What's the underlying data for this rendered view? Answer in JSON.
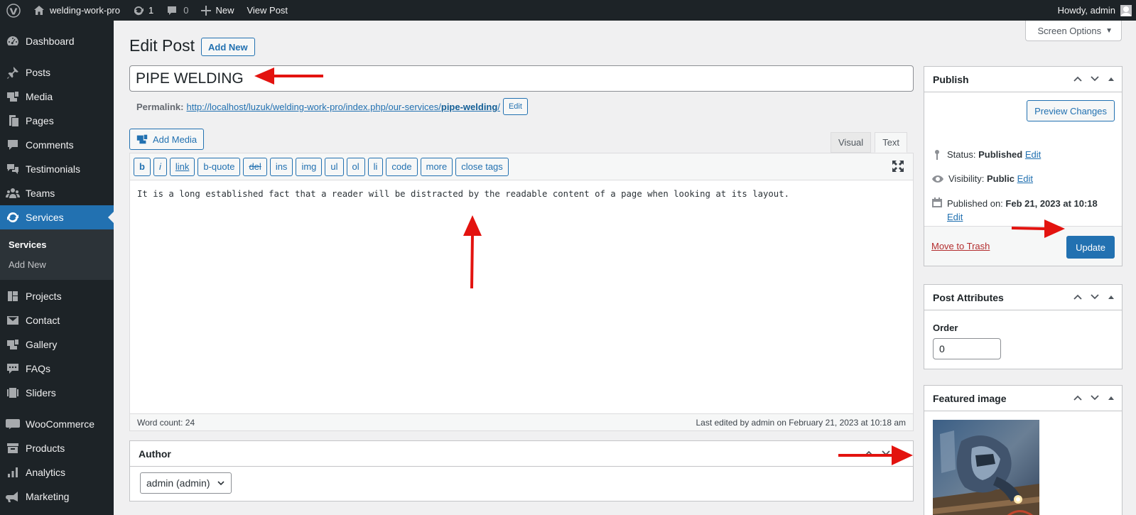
{
  "adminbar": {
    "site_name": "welding-work-pro",
    "updates_count": "1",
    "comments_count": "0",
    "new_label": "New",
    "view_post_label": "View Post",
    "howdy_label": "Howdy, admin"
  },
  "sidebar": {
    "items": [
      {
        "label": "Dashboard",
        "icon": "dashboard-icon"
      },
      {
        "label": "Posts",
        "icon": "pin-icon"
      },
      {
        "label": "Media",
        "icon": "media-icon"
      },
      {
        "label": "Pages",
        "icon": "pages-icon"
      },
      {
        "label": "Comments",
        "icon": "comment-icon"
      },
      {
        "label": "Testimonials",
        "icon": "testimonial-icon"
      },
      {
        "label": "Teams",
        "icon": "groups-icon"
      },
      {
        "label": "Services",
        "icon": "update-icon"
      },
      {
        "label": "Projects",
        "icon": "portfolio-icon"
      },
      {
        "label": "Contact",
        "icon": "email-icon"
      },
      {
        "label": "Gallery",
        "icon": "gallery-icon"
      },
      {
        "label": "FAQs",
        "icon": "faq-icon"
      },
      {
        "label": "Sliders",
        "icon": "slides-icon"
      },
      {
        "label": "WooCommerce",
        "icon": "woo-icon"
      },
      {
        "label": "Products",
        "icon": "archive-icon"
      },
      {
        "label": "Analytics",
        "icon": "chart-icon"
      },
      {
        "label": "Marketing",
        "icon": "megaphone-icon"
      }
    ],
    "submenu": [
      "Services",
      "Add New"
    ]
  },
  "header": {
    "screen_options": "Screen Options",
    "title": "Edit Post",
    "add_new": "Add New"
  },
  "post": {
    "title": "PIPE WELDING",
    "permalink_label": "Permalink:",
    "permalink_base": "http://localhost/luzuk/welding-work-pro/index.php/our-services/",
    "permalink_slug": "pipe-welding",
    "permalink_tail": "/",
    "permalink_edit": "Edit"
  },
  "editor": {
    "add_media": "Add Media",
    "tabs": [
      "Visual",
      "Text"
    ],
    "active_tab": "Text",
    "quicktags": [
      "b",
      "i",
      "link",
      "b-quote",
      "del",
      "ins",
      "img",
      "ul",
      "ol",
      "li",
      "code",
      "more",
      "close tags"
    ],
    "content": "It is a long established fact that a reader will be distracted by the readable content of a page when looking at its layout.",
    "word_count": "Word count: 24",
    "last_edited": "Last edited by admin on February 21, 2023 at 10:18 am"
  },
  "author": {
    "title": "Author",
    "selected": "admin (admin)"
  },
  "publish": {
    "title": "Publish",
    "preview": "Preview Changes",
    "status_label": "Status:",
    "status_value": "Published",
    "visibility_label": "Visibility:",
    "visibility_value": "Public",
    "published_label": "Published on:",
    "published_value": "Feb 21, 2023 at 10:18",
    "edit": "Edit",
    "trash": "Move to Trash",
    "update": "Update"
  },
  "attributes": {
    "title": "Post Attributes",
    "order_label": "Order",
    "order_value": "0"
  },
  "featured": {
    "title": "Featured image"
  },
  "colors": {
    "accent": "#2271b1",
    "adminbar": "#1d2327",
    "annotation_arrow": "#e3130f",
    "trash": "#b32d2e"
  }
}
